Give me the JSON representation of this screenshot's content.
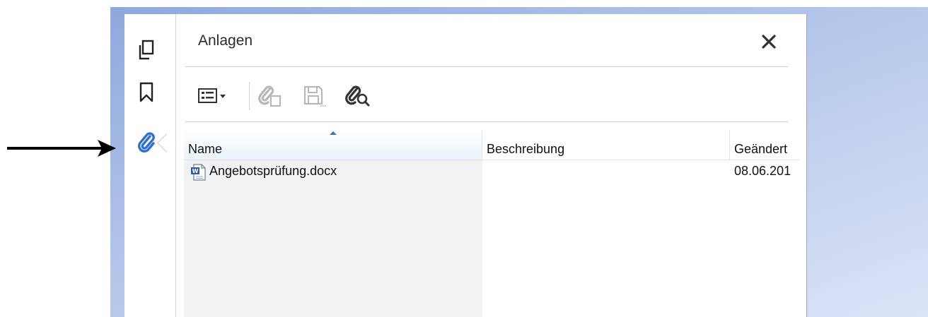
{
  "panel": {
    "title": "Anlagen",
    "nav": [
      {
        "icon": "pages-icon"
      },
      {
        "icon": "bookmark-icon"
      },
      {
        "icon": "paperclip-icon",
        "active": true
      }
    ],
    "toolbar": [
      {
        "icon": "list-view-dropdown-icon",
        "enabled": true
      },
      {
        "icon": "add-attachment-icon",
        "enabled": false
      },
      {
        "icon": "save-attachment-icon",
        "enabled": false
      },
      {
        "icon": "search-attachment-icon",
        "enabled": true
      }
    ]
  },
  "table": {
    "columns": {
      "name": "Name",
      "description": "Beschreibung",
      "changed": "Geändert"
    },
    "rows": [
      {
        "name": "Angebotsprüfung.docx",
        "description": "",
        "changed": "08.06.201",
        "icon": "word-document-icon"
      }
    ]
  },
  "colors": {
    "accent": "#2f6fd6",
    "backdrop": "#9fb4e3",
    "header_highlight": "#e8f3fc"
  }
}
